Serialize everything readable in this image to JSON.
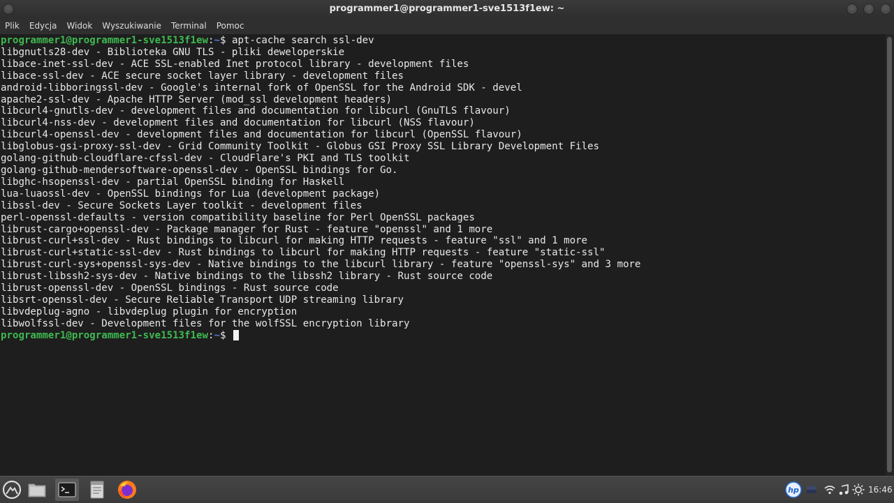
{
  "window": {
    "title": "programmer1@programmer1-sve1513f1ew: ~"
  },
  "menu": {
    "items": [
      "Plik",
      "Edycja",
      "Widok",
      "Wyszukiwanie",
      "Terminal",
      "Pomoc"
    ]
  },
  "terminal": {
    "prompt_user": "programmer1@programmer1-sve1513f1ew",
    "prompt_path": "~",
    "command": "apt-cache search ssl-dev",
    "output": [
      "libgnutls28-dev - Biblioteka GNU TLS - pliki deweloperskie",
      "libace-inet-ssl-dev - ACE SSL-enabled Inet protocol library - development files",
      "libace-ssl-dev - ACE secure socket layer library - development files",
      "android-libboringssl-dev - Google's internal fork of OpenSSL for the Android SDK - devel",
      "apache2-ssl-dev - Apache HTTP Server (mod_ssl development headers)",
      "libcurl4-gnutls-dev - development files and documentation for libcurl (GnuTLS flavour)",
      "libcurl4-nss-dev - development files and documentation for libcurl (NSS flavour)",
      "libcurl4-openssl-dev - development files and documentation for libcurl (OpenSSL flavour)",
      "libglobus-gsi-proxy-ssl-dev - Grid Community Toolkit - Globus GSI Proxy SSL Library Development Files",
      "golang-github-cloudflare-cfssl-dev - CloudFlare's PKI and TLS toolkit",
      "golang-github-mendersoftware-openssl-dev - OpenSSL bindings for Go.",
      "libghc-hsopenssl-dev - partial OpenSSL binding for Haskell",
      "lua-luaossl-dev - OpenSSL bindings for Lua (development package)",
      "libssl-dev - Secure Sockets Layer toolkit - development files",
      "perl-openssl-defaults - version compatibility baseline for Perl OpenSSL packages",
      "librust-cargo+openssl-dev - Package manager for Rust - feature \"openssl\" and 1 more",
      "librust-curl+ssl-dev - Rust bindings to libcurl for making HTTP requests - feature \"ssl\" and 1 more",
      "librust-curl+static-ssl-dev - Rust bindings to libcurl for making HTTP requests - feature \"static-ssl\"",
      "librust-curl-sys+openssl-sys-dev - Native bindings to the libcurl library - feature \"openssl-sys\" and 3 more",
      "librust-libssh2-sys-dev - Native bindings to the libssh2 library - Rust source code",
      "librust-openssl-dev - OpenSSL bindings - Rust source code",
      "libsrt-openssl-dev - Secure Reliable Transport UDP streaming library",
      "libvdeplug-agno - libvdeplug plugin for encryption",
      "libwolfssl-dev - Development files for the wolfSSL encryption library"
    ]
  },
  "taskbar": {
    "apps": [
      "menu-icon",
      "files-icon",
      "terminal-icon",
      "text-editor-icon",
      "firefox-icon"
    ],
    "clock": "16:46"
  },
  "colors": {
    "prompt_user": "#3fb950",
    "prompt_path": "#4e7fd6",
    "terminal_bg": "#1e1e1e"
  }
}
